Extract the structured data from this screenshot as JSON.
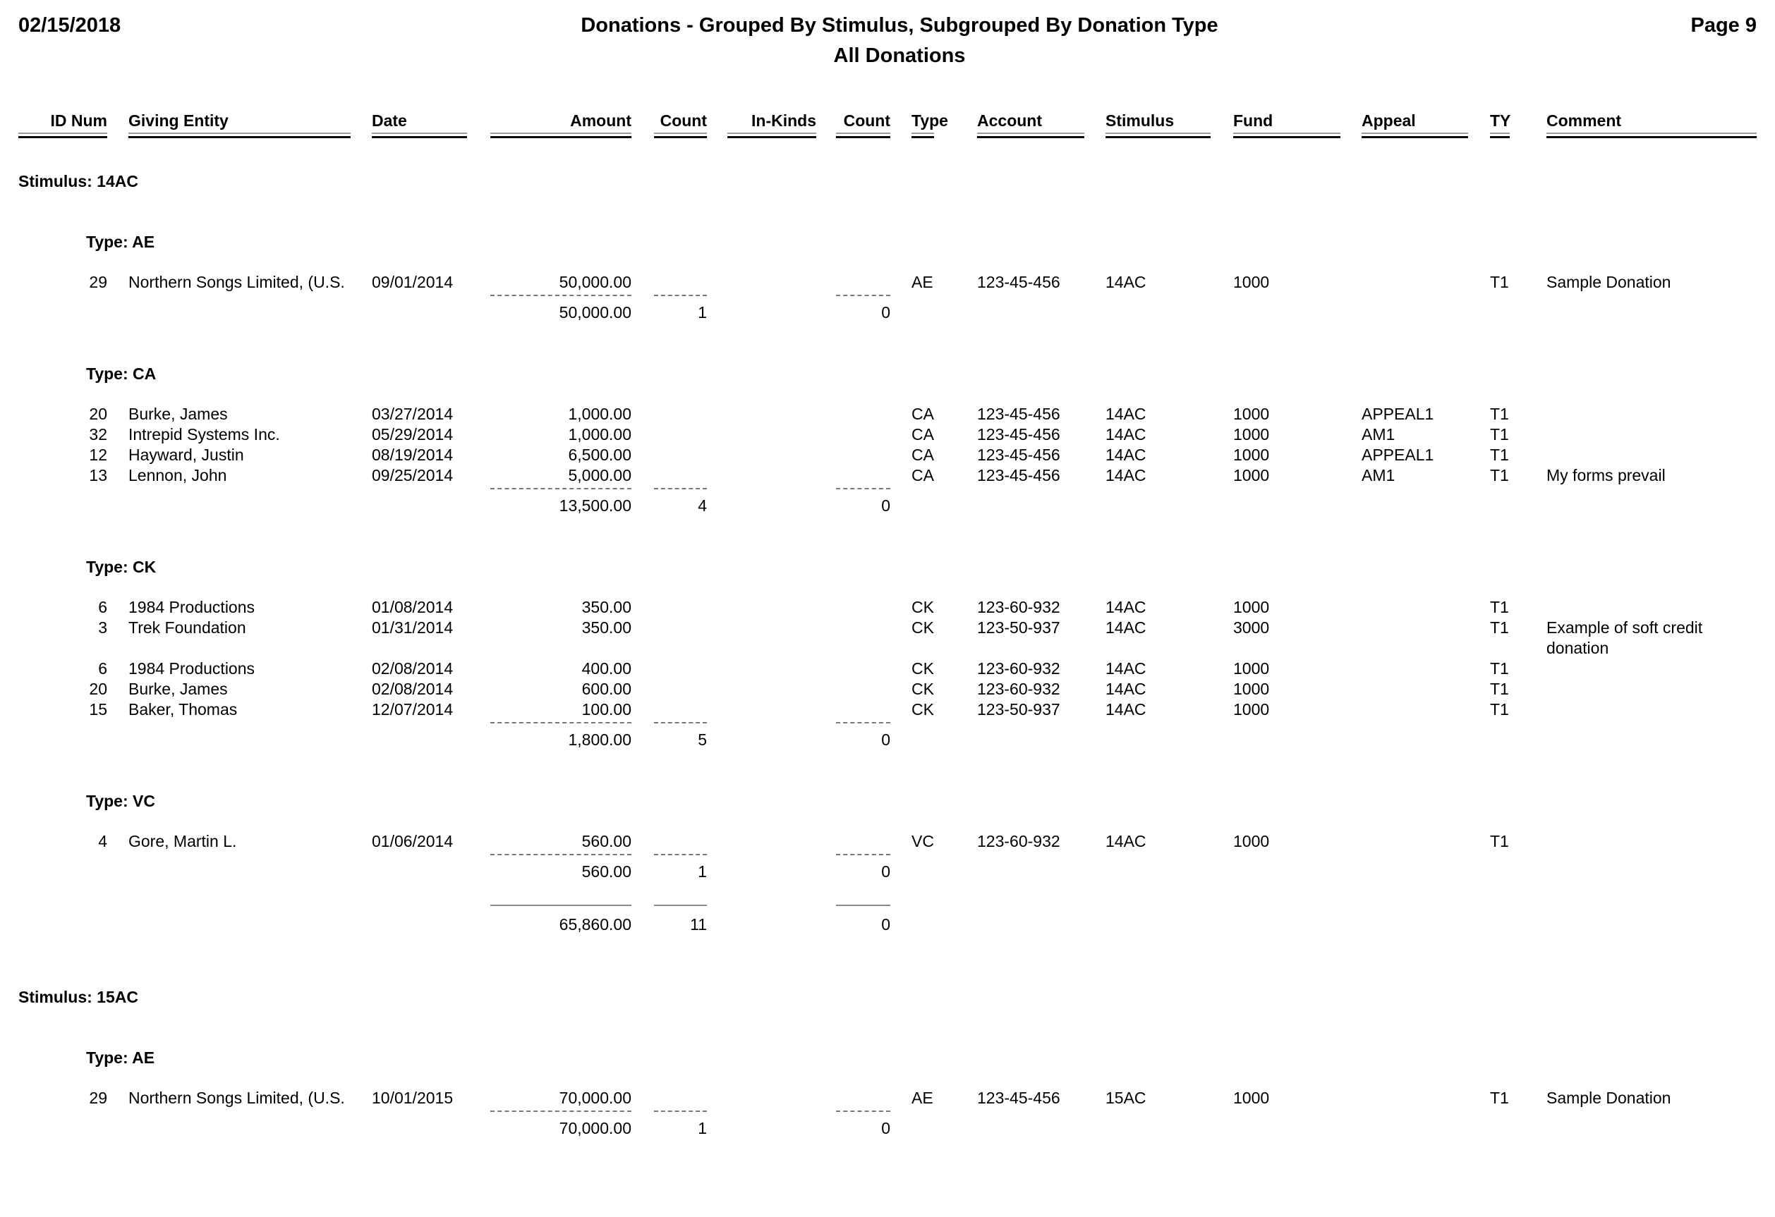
{
  "header": {
    "date": "02/15/2018",
    "title": "Donations - Grouped By Stimulus, Subgrouped By Donation Type",
    "subtitle": "All Donations",
    "page": "Page 9"
  },
  "columns": [
    {
      "key": "id",
      "label": "ID Num"
    },
    {
      "key": "entity",
      "label": "Giving Entity"
    },
    {
      "key": "date",
      "label": "Date"
    },
    {
      "key": "amount",
      "label": "Amount"
    },
    {
      "key": "count",
      "label": "Count"
    },
    {
      "key": "inkinds",
      "label": "In-Kinds"
    },
    {
      "key": "ikcount",
      "label": "Count"
    },
    {
      "key": "type",
      "label": "Type"
    },
    {
      "key": "account",
      "label": "Account"
    },
    {
      "key": "stimulus",
      "label": "Stimulus"
    },
    {
      "key": "fund",
      "label": "Fund"
    },
    {
      "key": "appeal",
      "label": "Appeal"
    },
    {
      "key": "ty",
      "label": "TY"
    },
    {
      "key": "comment",
      "label": "Comment"
    }
  ],
  "stimuli": [
    {
      "label": "Stimulus: 14AC",
      "types": [
        {
          "label": "Type: AE",
          "rows": [
            {
              "id": "29",
              "entity": "Northern Songs Limited, (U.S.",
              "date": "09/01/2014",
              "amount": "50,000.00",
              "type": "AE",
              "account": "123-45-456",
              "stimulus": "14AC",
              "fund": "1000",
              "appeal": "",
              "ty": "T1",
              "comment": "Sample Donation"
            }
          ],
          "subtotal": {
            "amount": "50,000.00",
            "count": "1",
            "ikcount": "0"
          }
        },
        {
          "label": "Type: CA",
          "rows": [
            {
              "id": "20",
              "entity": "Burke, James",
              "date": "03/27/2014",
              "amount": "1,000.00",
              "type": "CA",
              "account": "123-45-456",
              "stimulus": "14AC",
              "fund": "1000",
              "appeal": "APPEAL1",
              "ty": "T1",
              "comment": ""
            },
            {
              "id": "32",
              "entity": "Intrepid Systems Inc.",
              "date": "05/29/2014",
              "amount": "1,000.00",
              "type": "CA",
              "account": "123-45-456",
              "stimulus": "14AC",
              "fund": "1000",
              "appeal": "AM1",
              "ty": "T1",
              "comment": ""
            },
            {
              "id": "12",
              "entity": "Hayward, Justin",
              "date": "08/19/2014",
              "amount": "6,500.00",
              "type": "CA",
              "account": "123-45-456",
              "stimulus": "14AC",
              "fund": "1000",
              "appeal": "APPEAL1",
              "ty": "T1",
              "comment": ""
            },
            {
              "id": "13",
              "entity": "Lennon, John",
              "date": "09/25/2014",
              "amount": "5,000.00",
              "type": "CA",
              "account": "123-45-456",
              "stimulus": "14AC",
              "fund": "1000",
              "appeal": "AM1",
              "ty": "T1",
              "comment": "My forms prevail"
            }
          ],
          "subtotal": {
            "amount": "13,500.00",
            "count": "4",
            "ikcount": "0"
          }
        },
        {
          "label": "Type: CK",
          "rows": [
            {
              "id": "6",
              "entity": "1984 Productions",
              "date": "01/08/2014",
              "amount": "350.00",
              "type": "CK",
              "account": "123-60-932",
              "stimulus": "14AC",
              "fund": "1000",
              "appeal": "",
              "ty": "T1",
              "comment": ""
            },
            {
              "id": "3",
              "entity": "Trek Foundation",
              "date": "01/31/2014",
              "amount": "350.00",
              "type": "CK",
              "account": "123-50-937",
              "stimulus": "14AC",
              "fund": "3000",
              "appeal": "",
              "ty": "T1",
              "comment": "Example of soft credit",
              "comment2": "donation"
            },
            {
              "id": "6",
              "entity": "1984 Productions",
              "date": "02/08/2014",
              "amount": "400.00",
              "type": "CK",
              "account": "123-60-932",
              "stimulus": "14AC",
              "fund": "1000",
              "appeal": "",
              "ty": "T1",
              "comment": ""
            },
            {
              "id": "20",
              "entity": "Burke, James",
              "date": "02/08/2014",
              "amount": "600.00",
              "type": "CK",
              "account": "123-60-932",
              "stimulus": "14AC",
              "fund": "1000",
              "appeal": "",
              "ty": "T1",
              "comment": ""
            },
            {
              "id": "15",
              "entity": "Baker, Thomas",
              "date": "12/07/2014",
              "amount": "100.00",
              "type": "CK",
              "account": "123-50-937",
              "stimulus": "14AC",
              "fund": "1000",
              "appeal": "",
              "ty": "T1",
              "comment": ""
            }
          ],
          "subtotal": {
            "amount": "1,800.00",
            "count": "5",
            "ikcount": "0"
          }
        },
        {
          "label": "Type: VC",
          "rows": [
            {
              "id": "4",
              "entity": "Gore, Martin L.",
              "date": "01/06/2014",
              "amount": "560.00",
              "type": "VC",
              "account": "123-60-932",
              "stimulus": "14AC",
              "fund": "1000",
              "appeal": "",
              "ty": "T1",
              "comment": ""
            }
          ],
          "subtotal": {
            "amount": "560.00",
            "count": "1",
            "ikcount": "0"
          }
        }
      ],
      "total": {
        "amount": "65,860.00",
        "count": "11",
        "ikcount": "0"
      }
    },
    {
      "label": "Stimulus: 15AC",
      "types": [
        {
          "label": "Type: AE",
          "rows": [
            {
              "id": "29",
              "entity": "Northern Songs Limited, (U.S.",
              "date": "10/01/2015",
              "amount": "70,000.00",
              "type": "AE",
              "account": "123-45-456",
              "stimulus": "15AC",
              "fund": "1000",
              "appeal": "",
              "ty": "T1",
              "comment": "Sample Donation"
            }
          ],
          "subtotal": {
            "amount": "70,000.00",
            "count": "1",
            "ikcount": "0"
          }
        }
      ]
    }
  ]
}
